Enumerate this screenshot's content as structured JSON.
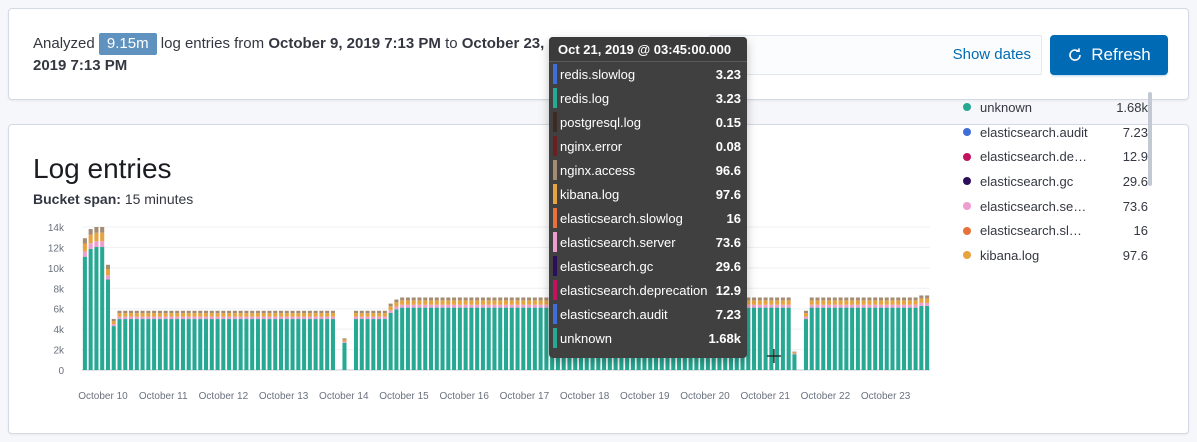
{
  "summary": {
    "prefix": "Analyzed",
    "count": "9.15m",
    "middle": "log entries from",
    "from": "October 9, 2019 7:13 PM",
    "to_word": "to",
    "to": "October 23, 2019 7:13 PM"
  },
  "toolbar": {
    "show_dates": "Show dates",
    "refresh": "Refresh"
  },
  "chart_panel": {
    "title": "Log entries",
    "bucket_label": "Bucket span:",
    "bucket_value": "15 minutes"
  },
  "tooltip": {
    "header": "Oct 21, 2019 @ 03:45:00.000",
    "rows": [
      {
        "name": "redis.slowlog",
        "value": "3.23",
        "color": "#3f6ed8"
      },
      {
        "name": "redis.log",
        "value": "3.23",
        "color": "#26a893"
      },
      {
        "name": "postgresql.log",
        "value": "0.15",
        "color": "#3b2b23"
      },
      {
        "name": "nginx.error",
        "value": "0.08",
        "color": "#6b1f1f"
      },
      {
        "name": "nginx.access",
        "value": "96.6",
        "color": "#a48b73"
      },
      {
        "name": "kibana.log",
        "value": "97.6",
        "color": "#e7a33e"
      },
      {
        "name": "elasticsearch.slowlog",
        "value": "16",
        "color": "#e7713b"
      },
      {
        "name": "elasticsearch.server",
        "value": "73.6",
        "color": "#ee9dd0"
      },
      {
        "name": "elasticsearch.gc",
        "value": "29.6",
        "color": "#2c0f5c"
      },
      {
        "name": "elasticsearch.deprecation",
        "value": "12.9",
        "color": "#c2135f"
      },
      {
        "name": "elasticsearch.audit",
        "value": "7.23",
        "color": "#3f6ed8"
      },
      {
        "name": "unknown",
        "value": "1.68k",
        "color": "#26a893"
      }
    ]
  },
  "legend": [
    {
      "name": "unknown",
      "value": "1.68k",
      "color": "#26a893"
    },
    {
      "name": "elasticsearch.audit",
      "value": "7.23",
      "color": "#3f6ed8"
    },
    {
      "name": "elasticsearch.deprecation",
      "value": "12.9",
      "color": "#c2135f"
    },
    {
      "name": "elasticsearch.gc",
      "value": "29.6",
      "color": "#2c0f5c"
    },
    {
      "name": "elasticsearch.server",
      "value": "73.6",
      "color": "#ee9dd0"
    },
    {
      "name": "elasticsearch.slowlog",
      "value": "16",
      "color": "#e7713b"
    },
    {
      "name": "kibana.log",
      "value": "97.6",
      "color": "#e7a33e"
    }
  ],
  "chart_data": {
    "type": "bar",
    "stacked": true,
    "ylim": [
      0,
      14000
    ],
    "y_ticks": [
      "0",
      "2k",
      "4k",
      "6k",
      "8k",
      "10k",
      "12k",
      "14k"
    ],
    "x_tick_labels": [
      "October 10",
      "October 11",
      "October 12",
      "October 13",
      "October 14",
      "October 15",
      "October 16",
      "October 17",
      "October 18",
      "October 19",
      "October 20",
      "October 21",
      "October 22",
      "October 23"
    ],
    "colors": {
      "base": "#26a893",
      "mid": "#e7a33e",
      "top": "#ee9dd0",
      "cap": "#a48b73"
    },
    "totals": [
      12900,
      13800,
      14000,
      14000,
      10300,
      5000,
      5800,
      5800,
      5800,
      5800,
      5800,
      5800,
      5800,
      5800,
      5800,
      5800,
      5800,
      5800,
      5800,
      5800,
      5800,
      5800,
      5800,
      5800,
      5800,
      5800,
      5800,
      5800,
      5800,
      5800,
      5800,
      5800,
      5800,
      5800,
      5800,
      5800,
      5800,
      5800,
      5800,
      5800,
      5800,
      5800,
      5800,
      5800,
      0,
      3100,
      0,
      5800,
      5800,
      5800,
      5800,
      5800,
      5800,
      6500,
      6900,
      7100,
      7100,
      7100,
      7100,
      7100,
      7100,
      7100,
      7100,
      7100,
      7100,
      7100,
      7100,
      7100,
      7100,
      7100,
      7100,
      7100,
      7100,
      7100,
      7100,
      7100,
      7100,
      7100,
      7100,
      7100,
      7100,
      7100,
      7100,
      7100,
      7100,
      7100,
      7100,
      7100,
      7100,
      7100,
      7100,
      7100,
      7100,
      7100,
      7100,
      7100,
      7100,
      7100,
      7100,
      7100,
      7100,
      7100,
      7100,
      7100,
      7100,
      7100,
      7100,
      7100,
      7100,
      7100,
      7100,
      7100,
      7100,
      7100,
      7100,
      7100,
      7100,
      7100,
      7100,
      7100,
      7100,
      7100,
      7100,
      1800,
      0,
      5800,
      7100,
      7100,
      7100,
      7100,
      7100,
      7100,
      7100,
      7100,
      7100,
      7100,
      7100,
      7100,
      7100,
      7100,
      7100,
      7100,
      7100,
      7100,
      7100,
      7300,
      7300
    ]
  }
}
